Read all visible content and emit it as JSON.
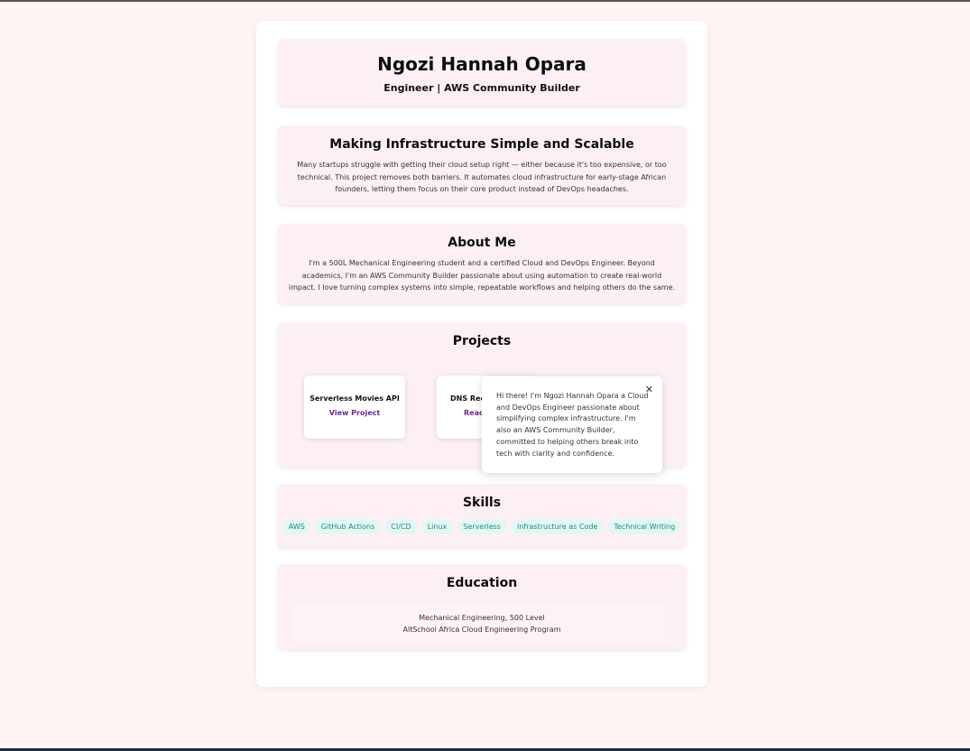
{
  "header": {
    "name": "Ngozi Hannah Opara",
    "tagline": "Engineer | AWS Community Builder"
  },
  "mission": {
    "title": "Making Infrastructure Simple and Scalable",
    "text": "Many startups struggle with getting their cloud setup right — either because it's too expensive, or too technical. This project removes both barriers. It automates cloud infrastructure for early-stage African founders, letting them focus on their core product instead of DevOps headaches."
  },
  "about": {
    "title": "About Me",
    "text": "I'm a 500L Mechanical Engineering student and a certified Cloud and DevOps Engineer. Beyond academics, I'm an AWS Community Builder passionate about using automation to create real-world impact. I love turning complex systems into simple, repeatable workflows and helping others do the same."
  },
  "projects": {
    "title": "Projects",
    "items": [
      {
        "title": "Serverless Movies API",
        "link_label": "View Project"
      },
      {
        "title": "DNS Reco",
        "link_label": "Read"
      }
    ]
  },
  "popup": {
    "close_icon": "close-icon",
    "text": "Hi there! I'm Ngozi Hannah Opara a Cloud and DevOps Engineer passionate about simplifying complex infrastructure. I'm also an AWS Community Builder, committed to helping others break into tech with clarity and confidence."
  },
  "skills": {
    "title": "Skills",
    "items": [
      "AWS",
      "GitHub Actions",
      "CI/CD",
      "Linux",
      "Serverless",
      "Infrastructure as Code",
      "Technical Writing"
    ]
  },
  "education": {
    "title": "Education",
    "line1": "Mechanical Engineering, 500 Level",
    "line2": "AltSchool Africa Cloud Engineering Program"
  },
  "colors": {
    "page_bg": "#fff5f5",
    "section_bg": "#fdf0f4",
    "link": "#6b2a8a",
    "skill_text": "#1e8a80",
    "skill_bg": "#e2f7f3"
  }
}
